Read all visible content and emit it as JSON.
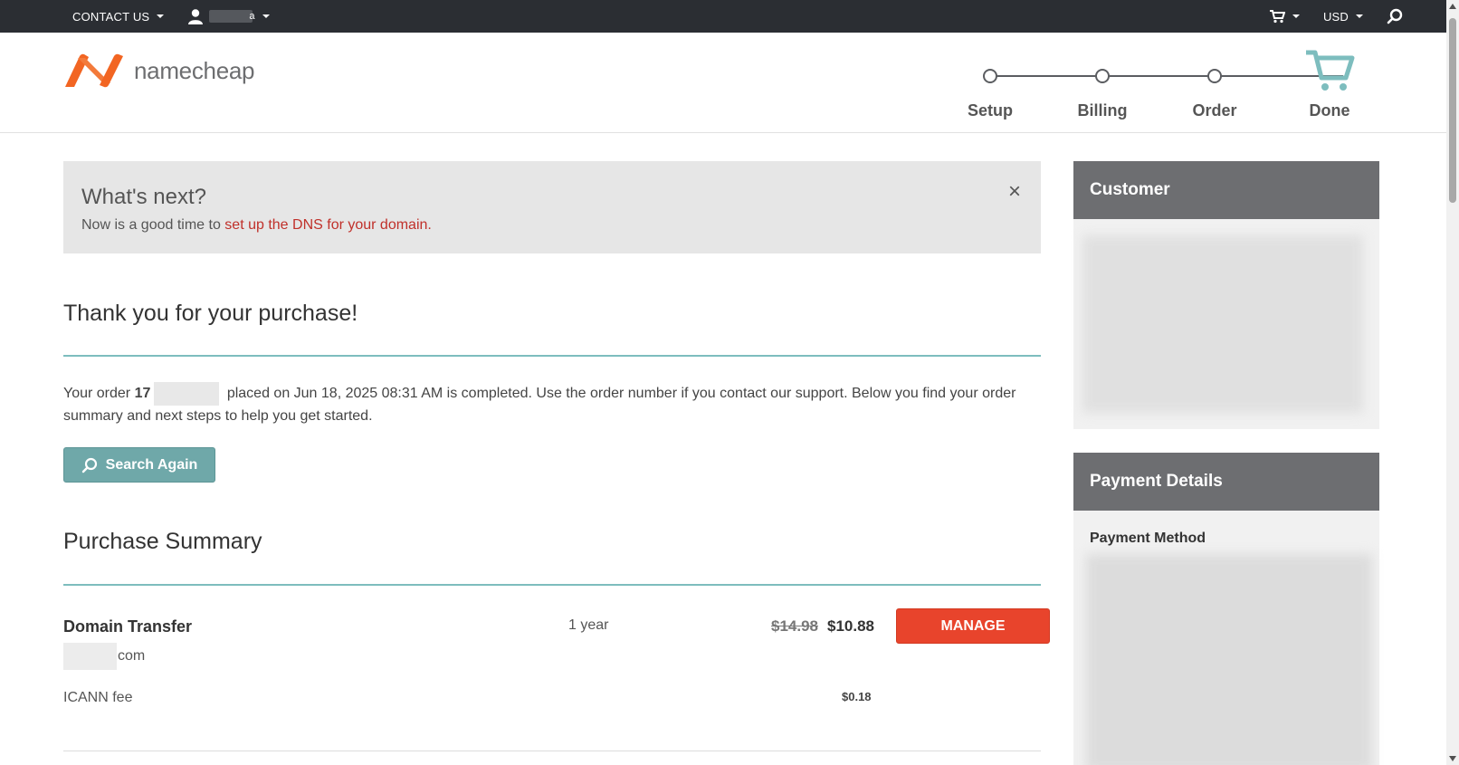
{
  "topbar": {
    "contact_us": "CONTACT US",
    "user_suffix": "a",
    "cart_icon": "cart-icon",
    "currency": "USD",
    "search_icon": "search-icon"
  },
  "header": {
    "logo_text": "namecheap",
    "steps": [
      {
        "label": "Setup"
      },
      {
        "label": "Billing"
      },
      {
        "label": "Order"
      },
      {
        "label": "Done"
      }
    ]
  },
  "whats_next": {
    "title": "What's next?",
    "text_prefix": "Now is a good time to ",
    "link_text": "set up the DNS for your domain.",
    "close_symbol": "×"
  },
  "thanks": {
    "title": "Thank you for your purchase!",
    "order_prefix": "Your order ",
    "order_number_visible": "17",
    "order_suffix": " placed on Jun 18, 2025 08:31 AM is completed. Use the order number if you contact our support. Below you find your order summary and next steps to help you get started."
  },
  "search_again": {
    "label": "Search Again"
  },
  "purchase_summary": {
    "title": "Purchase Summary",
    "item": {
      "name": "Domain Transfer",
      "domain_suffix": "com",
      "period": "1 year",
      "old_price": "$14.98",
      "price": "$10.88",
      "action": "MANAGE"
    },
    "icann": {
      "label": "ICANN fee",
      "price": "$0.18"
    }
  },
  "sidebar": {
    "customer": {
      "title": "Customer"
    },
    "payment": {
      "title": "Payment Details",
      "method_label": "Payment Method"
    }
  },
  "colors": {
    "topbar_bg": "#2b2e33",
    "accent_teal": "#7dbdbe",
    "link_red": "#c0302a",
    "manage_orange": "#e8442c",
    "logo_orange": "#f26522"
  }
}
